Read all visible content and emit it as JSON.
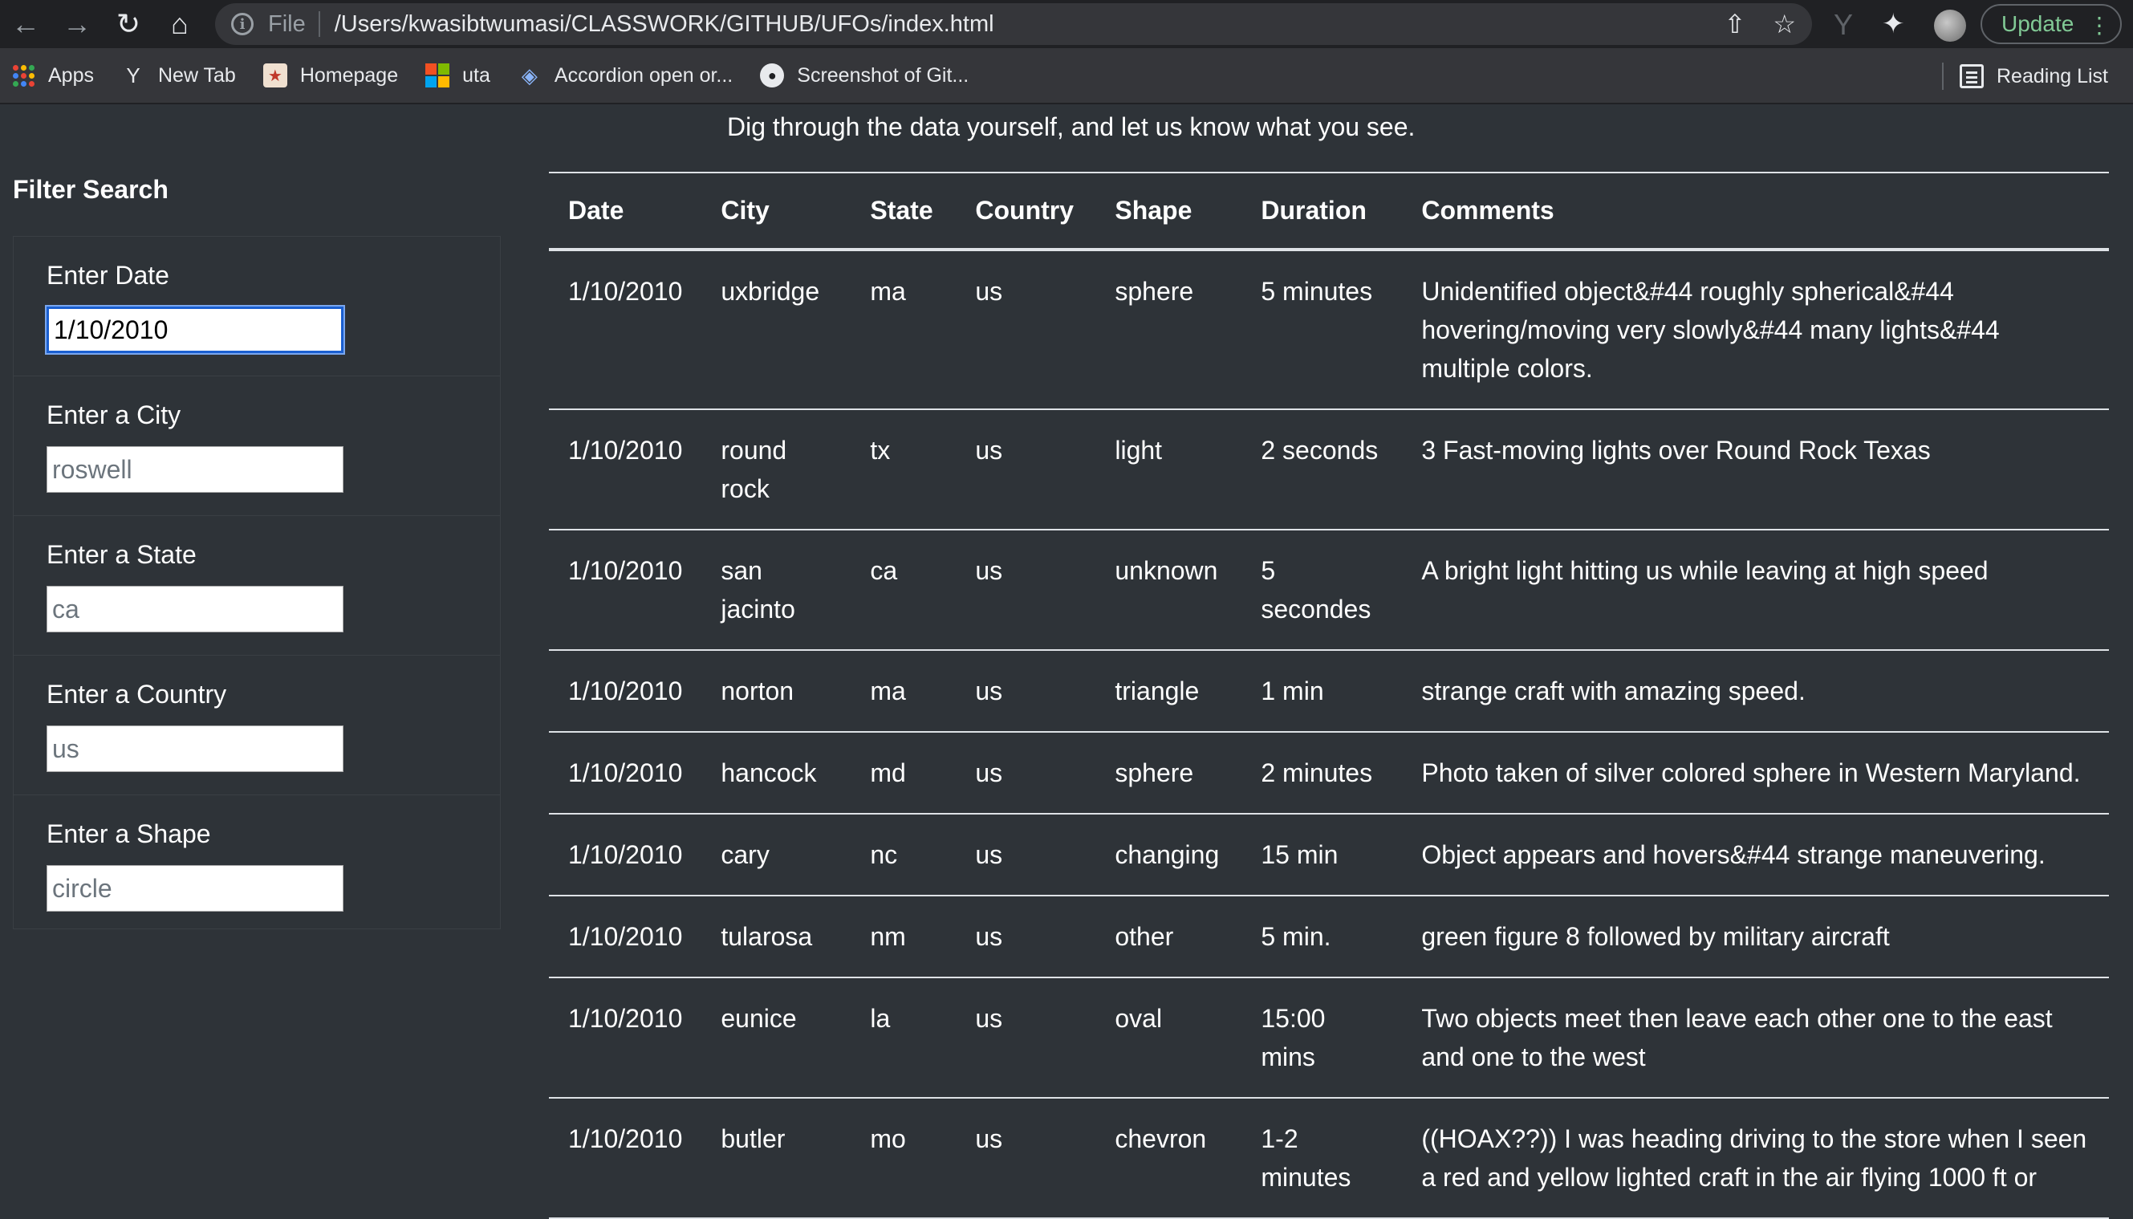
{
  "browser": {
    "scheme": "File",
    "url": "/Users/kwasibtwumasi/CLASSWORK/GITHUB/UFOs/index.html",
    "update_label": "Update",
    "bookmarks": [
      "Apps",
      "New Tab",
      "Homepage",
      "uta",
      "Accordion open or...",
      "Screenshot of Git..."
    ],
    "reading_list": "Reading List"
  },
  "page": {
    "intro": "Dig through the data yourself, and let us know what you see.",
    "filter_title": "Filter Search",
    "filters": [
      {
        "label": "Enter Date",
        "value": "1/10/2010",
        "placeholder": ""
      },
      {
        "label": "Enter a City",
        "value": "",
        "placeholder": "roswell"
      },
      {
        "label": "Enter a State",
        "value": "",
        "placeholder": "ca"
      },
      {
        "label": "Enter a Country",
        "value": "",
        "placeholder": "us"
      },
      {
        "label": "Enter a Shape",
        "value": "",
        "placeholder": "circle"
      }
    ]
  },
  "table": {
    "headers": [
      "Date",
      "City",
      "State",
      "Country",
      "Shape",
      "Duration",
      "Comments"
    ],
    "rows": [
      [
        "1/10/2010",
        "uxbridge",
        "ma",
        "us",
        "sphere",
        "5 minutes",
        "Unidentified object&#44 roughly spherical&#44 hovering/moving very slowly&#44 many lights&#44 multiple colors."
      ],
      [
        "1/10/2010",
        "round rock",
        "tx",
        "us",
        "light",
        "2 seconds",
        "3 Fast-moving lights over Round Rock Texas"
      ],
      [
        "1/10/2010",
        "san jacinto",
        "ca",
        "us",
        "unknown",
        "5 secondes",
        "A bright light hitting us while leaving at high speed"
      ],
      [
        "1/10/2010",
        "norton",
        "ma",
        "us",
        "triangle",
        "1 min",
        "strange craft with amazing speed."
      ],
      [
        "1/10/2010",
        "hancock",
        "md",
        "us",
        "sphere",
        "2 minutes",
        "Photo taken of silver colored sphere in Western Maryland."
      ],
      [
        "1/10/2010",
        "cary",
        "nc",
        "us",
        "changing",
        "15 min",
        "Object appears and hovers&#44 strange maneuvering."
      ],
      [
        "1/10/2010",
        "tularosa",
        "nm",
        "us",
        "other",
        "5 min.",
        "green figure 8 followed by military aircraft"
      ],
      [
        "1/10/2010",
        "eunice",
        "la",
        "us",
        "oval",
        "15:00 mins",
        "Two objects meet then leave each other one to the east and one to the west"
      ],
      [
        "1/10/2010",
        "butler",
        "mo",
        "us",
        "chevron",
        "1-2 minutes",
        "((HOAX??)) I was heading driving to the store when I seen a red and yellow lighted craft in the air flying 1000 ft or"
      ]
    ]
  }
}
